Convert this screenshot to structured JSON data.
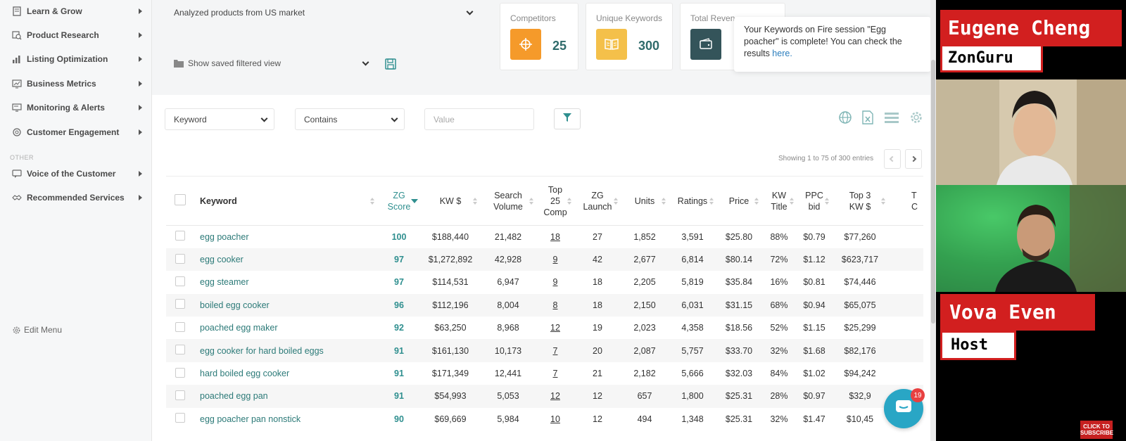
{
  "sidebar": {
    "items": [
      {
        "label": "Learn & Grow",
        "icon": "book-icon"
      },
      {
        "label": "Product Research",
        "icon": "magnifier-icon"
      },
      {
        "label": "Listing Optimization",
        "icon": "chart-icon"
      },
      {
        "label": "Business Metrics",
        "icon": "metrics-icon"
      },
      {
        "label": "Monitoring & Alerts",
        "icon": "monitor-icon"
      },
      {
        "label": "Customer Engagement",
        "icon": "engagement-icon"
      }
    ],
    "other_label": "OTHER",
    "other_items": [
      {
        "label": "Voice of the Customer",
        "icon": "voice-icon"
      },
      {
        "label": "Recommended Services",
        "icon": "handshake-icon"
      }
    ],
    "edit_menu": "Edit Menu"
  },
  "filters": {
    "market": "Analyzed products from US market",
    "saved_view": "Show saved filtered view",
    "field": "Keyword",
    "operator": "Contains",
    "value_placeholder": "Value"
  },
  "stats": [
    {
      "label": "Competitors",
      "value": "25",
      "color": "#f59a2a",
      "icon": "crosshair-icon"
    },
    {
      "label": "Unique Keywords",
      "value": "300",
      "color": "#f4c04a",
      "icon": "book-open-icon"
    },
    {
      "label": "Total Reven",
      "value": "",
      "color": "#34545a",
      "icon": "wallet-icon"
    }
  ],
  "notification": {
    "text": "Your Keywords on Fire session \"Egg poacher\" is complete! You can check the results ",
    "link": "here."
  },
  "pagination": {
    "entries": "Showing 1 to 75 of 300 entries"
  },
  "table": {
    "columns": [
      "Keyword",
      "ZG Score",
      "KW $",
      "Search Volume",
      "Top 25 Comp",
      "ZG Launch",
      "Units",
      "Ratings",
      "Price",
      "KW Title",
      "PPC bid",
      "Top 3 KW $",
      "T C"
    ],
    "rows": [
      [
        "egg poacher",
        "100",
        "$188,440",
        "21,482",
        "18",
        "27",
        "1,852",
        "3,591",
        "$25.80",
        "88%",
        "$0.79",
        "$77,260"
      ],
      [
        "egg cooker",
        "97",
        "$1,272,892",
        "42,928",
        "9",
        "42",
        "2,677",
        "6,814",
        "$80.14",
        "72%",
        "$1.12",
        "$623,717"
      ],
      [
        "egg steamer",
        "97",
        "$114,531",
        "6,947",
        "9",
        "18",
        "2,205",
        "5,819",
        "$35.84",
        "16%",
        "$0.81",
        "$74,446"
      ],
      [
        "boiled egg cooker",
        "96",
        "$112,196",
        "8,004",
        "8",
        "18",
        "2,150",
        "6,031",
        "$31.15",
        "68%",
        "$0.94",
        "$65,075"
      ],
      [
        "poached egg maker",
        "92",
        "$63,250",
        "8,968",
        "12",
        "19",
        "2,023",
        "4,358",
        "$18.56",
        "52%",
        "$1.15",
        "$25,299"
      ],
      [
        "egg cooker for hard boiled eggs",
        "91",
        "$161,130",
        "10,173",
        "7",
        "20",
        "2,087",
        "5,757",
        "$33.70",
        "32%",
        "$1.68",
        "$82,176"
      ],
      [
        "hard boiled egg cooker",
        "91",
        "$171,349",
        "12,441",
        "7",
        "21",
        "2,182",
        "5,666",
        "$32.03",
        "84%",
        "$1.02",
        "$94,242"
      ],
      [
        "poached egg pan",
        "91",
        "$54,993",
        "5,053",
        "12",
        "12",
        "657",
        "1,800",
        "$25.31",
        "28%",
        "$0.97",
        "$32,9"
      ],
      [
        "egg poacher pan nonstick",
        "90",
        "$69,669",
        "5,984",
        "10",
        "12",
        "494",
        "1,348",
        "$25.31",
        "32%",
        "$1.47",
        "$10,45"
      ]
    ]
  },
  "chat": {
    "badge": "19"
  },
  "video": {
    "guest_name": "Eugene Cheng",
    "guest_company": "ZonGuru",
    "host_name": "Vova Even",
    "host_role": "Host",
    "subscribe": "CLICK TO SUBSCRIBE"
  }
}
